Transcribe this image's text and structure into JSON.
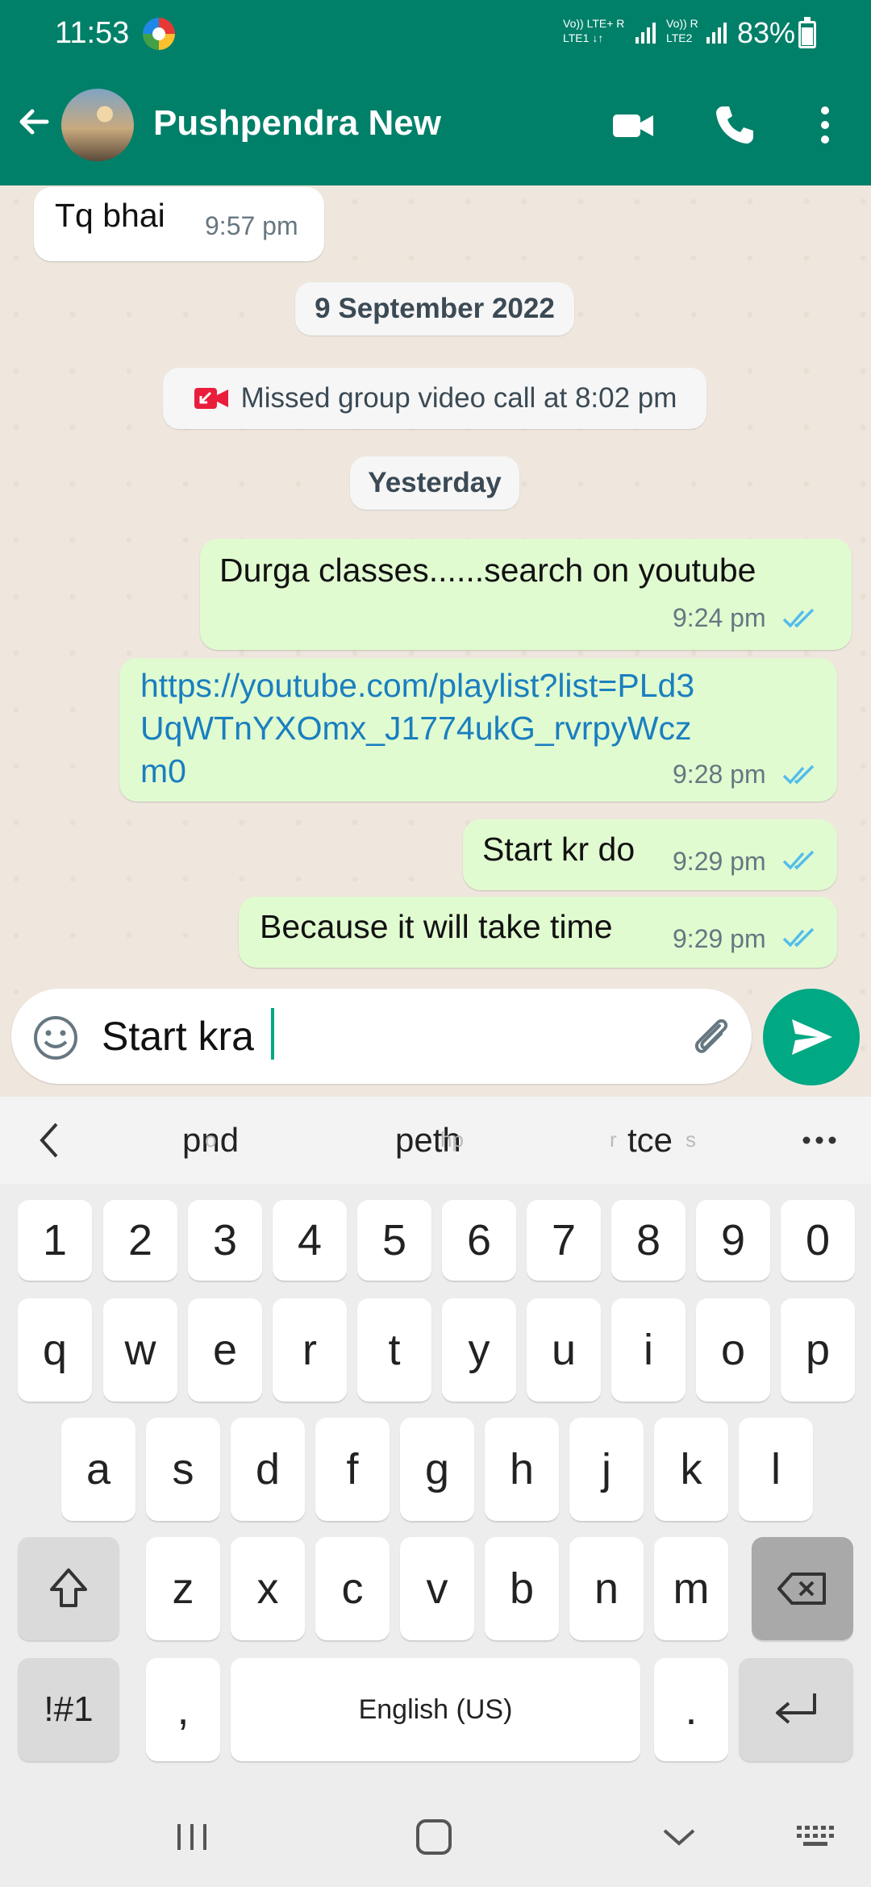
{
  "status_bar": {
    "time": "11:53",
    "network_1": "Vo)) LTE+ R",
    "network_1_sub": "LTE1 ↓↑",
    "network_2": "Vo)) R",
    "network_2_sub": "LTE2",
    "battery": "83%"
  },
  "header": {
    "contact_name": "Pushpendra New",
    "icons": [
      "back-arrow-icon",
      "video-call-icon",
      "voice-call-icon",
      "more-vert-icon"
    ],
    "color": "#008069"
  },
  "chat": {
    "messages": [
      {
        "direction": "in",
        "text": "Tq bhai",
        "time": "9:57 pm"
      },
      {
        "type": "date",
        "text": "9 September 2022"
      },
      {
        "type": "system",
        "text": "Missed group video call at 8:02 pm",
        "icon": "missed-video-call-icon"
      },
      {
        "type": "date",
        "text": "Yesterday"
      },
      {
        "direction": "out",
        "text": "Durga classes......search on youtube",
        "time": "9:24 pm",
        "status": "read"
      },
      {
        "direction": "out",
        "text": "https://youtube.com/playlist?list=PLd3UqWTnYXOmx_J1774ukG_rvrpyWczm0",
        "time": "9:28 pm",
        "status": "read"
      },
      {
        "direction": "out",
        "text": "Start kr do",
        "time": "9:29 pm",
        "status": "read"
      },
      {
        "direction": "out",
        "text": "Because it will take time",
        "time": "9:29 pm",
        "status": "read"
      }
    ],
    "bubble_out_color": "#E1FBD1",
    "link_color": "#1a7fbf",
    "tick_color": "#53bdeb"
  },
  "composer": {
    "value": "Start kra",
    "send_color": "#00a884"
  },
  "keyboard": {
    "suggestions": [
      "pnd",
      "peth",
      "tce"
    ],
    "ghost_suggestions": [
      "o",
      "hp",
      "r",
      "s"
    ],
    "number_row": [
      "1",
      "2",
      "3",
      "4",
      "5",
      "6",
      "7",
      "8",
      "9",
      "0"
    ],
    "row1": [
      "q",
      "w",
      "e",
      "r",
      "t",
      "y",
      "u",
      "i",
      "o",
      "p"
    ],
    "row2": [
      "a",
      "s",
      "d",
      "f",
      "g",
      "h",
      "j",
      "k",
      "l"
    ],
    "row3": [
      "z",
      "x",
      "c",
      "v",
      "b",
      "n",
      "m"
    ],
    "symbols_key": "!#1",
    "comma_key": ",",
    "space_label": "English (US)",
    "period_key": "."
  }
}
